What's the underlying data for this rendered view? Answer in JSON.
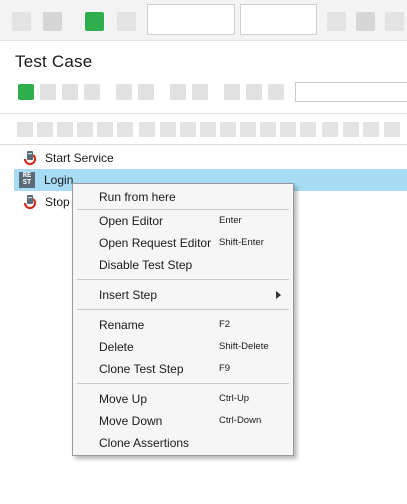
{
  "colors": {
    "selected_row": "#a7dcf4",
    "run_green": "#2fae4e",
    "menu_bg": "#f6f6f6"
  },
  "panel": {
    "title": "Test Case"
  },
  "steps": [
    {
      "label": "Start Service",
      "icon": "start-service-icon"
    },
    {
      "label": "Login",
      "icon": "rest-request-icon",
      "selected": true
    },
    {
      "label": "Stop",
      "icon": "stop-service-icon"
    }
  ],
  "context_menu": {
    "items": [
      {
        "label": "Run from here",
        "shortcut": ""
      },
      {
        "label": "Open Editor",
        "shortcut": "Enter"
      },
      {
        "label": "Open Request Editor",
        "shortcut": "Shift-Enter"
      },
      {
        "label": "Disable Test Step",
        "shortcut": ""
      },
      {
        "label": "Insert Step",
        "shortcut": "",
        "submenu": true
      },
      {
        "label": "Rename",
        "shortcut": "F2"
      },
      {
        "label": "Delete",
        "shortcut": "Shift-Delete"
      },
      {
        "label": "Clone Test Step",
        "shortcut": "F9"
      },
      {
        "label": "Move Up",
        "shortcut": "Ctrl-Up"
      },
      {
        "label": "Move Down",
        "shortcut": "Ctrl-Down"
      },
      {
        "label": "Clone Assertions",
        "shortcut": ""
      }
    ]
  }
}
